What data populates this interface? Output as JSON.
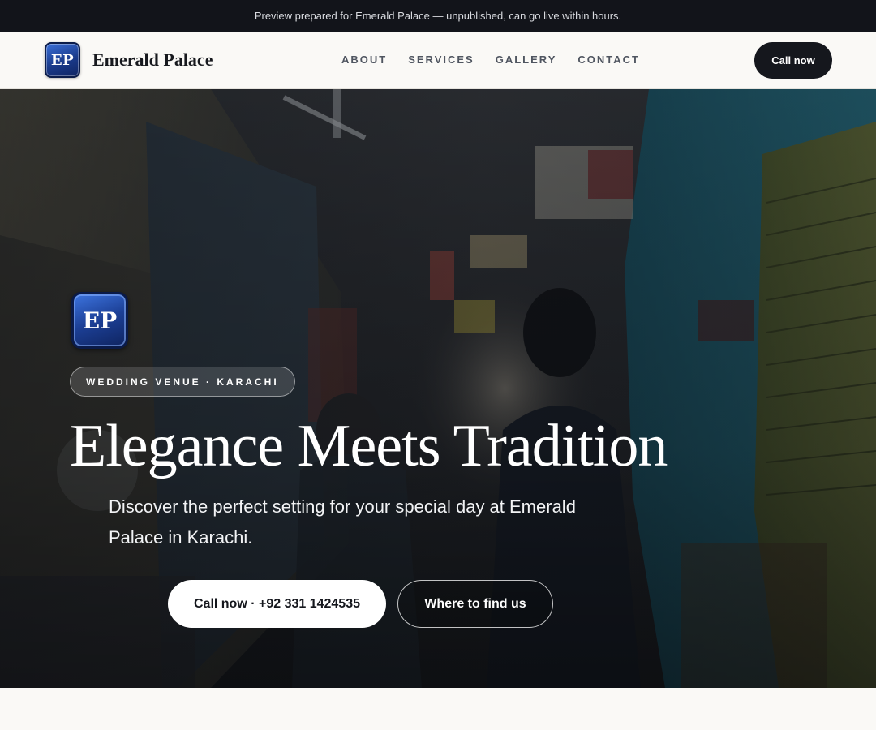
{
  "announcement": "Preview prepared for Emerald Palace — unpublished, can go live within hours.",
  "header": {
    "logo_initials": "EP",
    "brand_name": "Emerald Palace",
    "nav": [
      "ABOUT",
      "SERVICES",
      "GALLERY",
      "CONTACT"
    ],
    "cta_label": "Call now"
  },
  "hero": {
    "logo_initials": "EP",
    "badge": "WEDDING VENUE · KARACHI",
    "headline": "Elegance Meets Tradition",
    "subtitle": "Discover the perfect setting for your special day at Emerald Palace in Karachi.",
    "primary_cta": "Call now · +92 331 1424535",
    "secondary_cta": "Where to find us",
    "background": "dim photo of a narrow market alley with shop stalls"
  },
  "colors": {
    "topbar": "#12141a",
    "page_bg": "#faf9f6",
    "dark_button": "#15171d",
    "logo_blue": "#1c3f95",
    "accent_teal": "#1aa3b8"
  }
}
